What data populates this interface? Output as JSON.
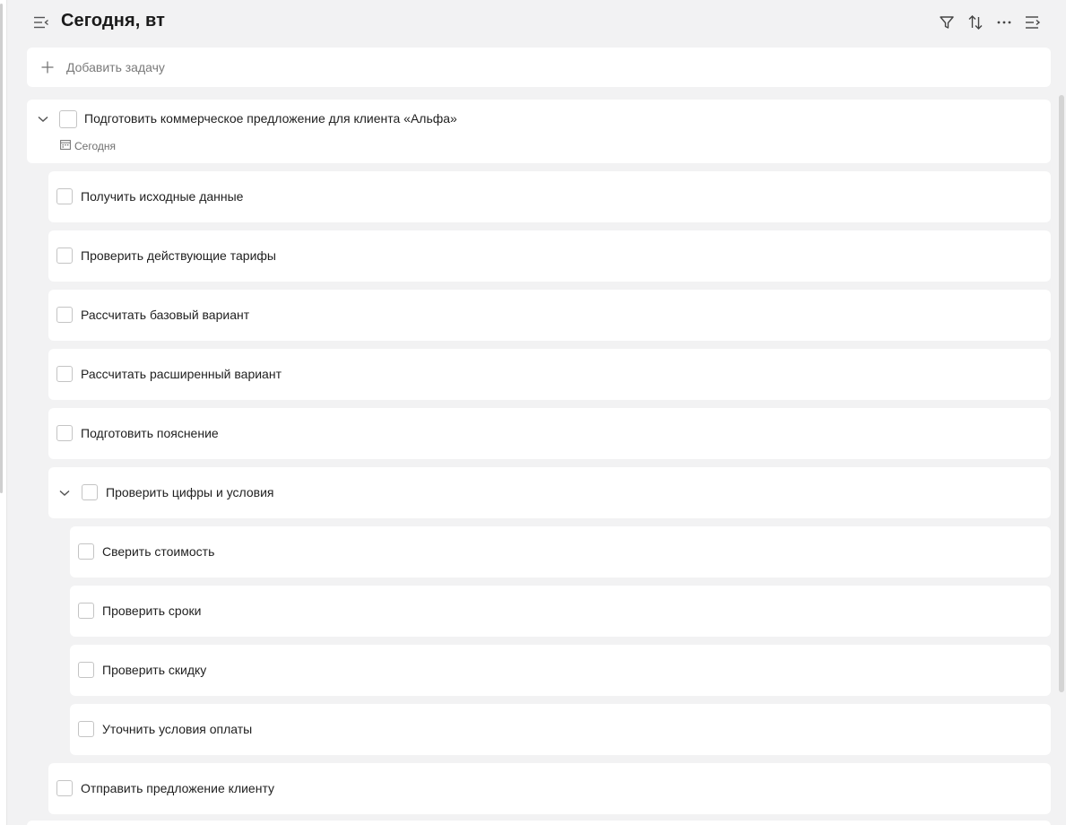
{
  "header": {
    "title": "Сегодня, вт",
    "icons": [
      "menu-collapse-icon",
      "filter-icon",
      "sort-icon",
      "more-icon",
      "details-panel-icon"
    ]
  },
  "add_task": {
    "label": "Добавить задачу",
    "icon": "plus-icon"
  },
  "parent_task": {
    "label": "Подготовить коммерческое предложение для клиента «Альфа»",
    "date": "Сегодня",
    "date_icon": "calendar-icon",
    "expanded": true
  },
  "subtasks": [
    {
      "label": "Получить исходные данные"
    },
    {
      "label": "Проверить действующие тарифы"
    },
    {
      "label": "Рассчитать базовый вариант"
    },
    {
      "label": "Рассчитать расширенный вариант"
    },
    {
      "label": "Подготовить пояснение"
    },
    {
      "label": "Проверить цифры и условия",
      "expanded": true
    },
    {
      "label": "Сверить стоимость"
    },
    {
      "label": "Проверить сроки"
    },
    {
      "label": "Проверить скидку"
    },
    {
      "label": "Уточнить условия оплаты"
    },
    {
      "label": "Отправить предложение клиенту"
    }
  ],
  "colors": {
    "background": "#f2f2f3",
    "card": "#ffffff",
    "checkbox_border": "#c4c4c4",
    "text": "#1f1f1f",
    "muted_text": "#7a7a7a"
  }
}
